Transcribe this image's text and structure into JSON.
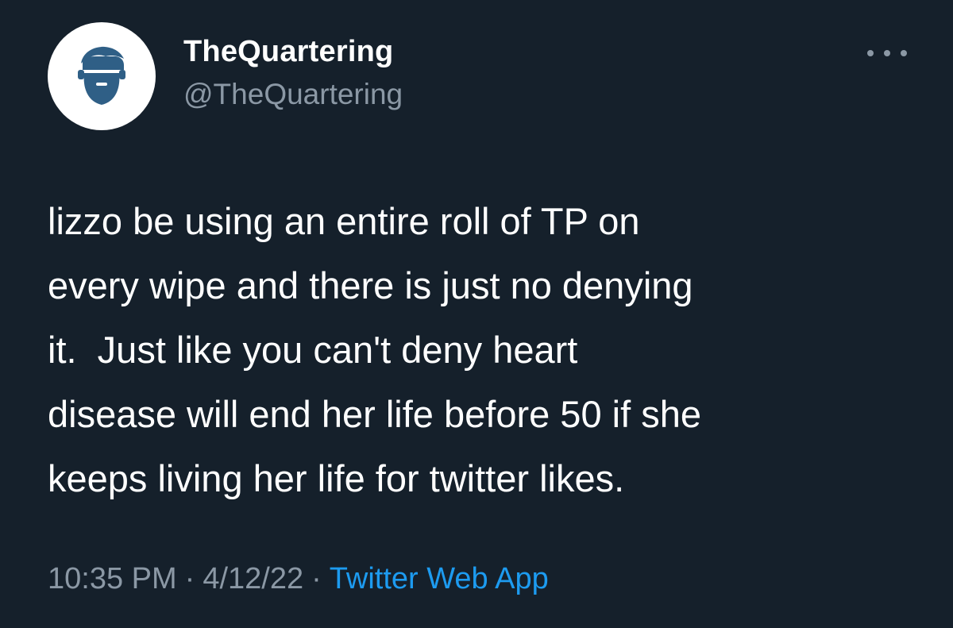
{
  "author": {
    "display_name": "TheQuartering",
    "handle": "@TheQuartering",
    "avatar_icon": "bearded-man-icon"
  },
  "more_icon": "more-dots-icon",
  "tweet": {
    "lines": [
      "lizzo be using an entire roll of TP on",
      "every wipe and there is just no denying",
      "it.  Just like you can't deny heart",
      "disease will end her life before 50 if she",
      "keeps living her life for twitter likes."
    ]
  },
  "meta": {
    "time": "10:35 PM",
    "separator": "·",
    "date": "4/12/22",
    "source": "Twitter Web App"
  },
  "colors": {
    "background": "#15202b",
    "text": "#ffffff",
    "secondary_text": "#8b98a5",
    "link": "#1d9bf0",
    "avatar_bg": "#ffffff",
    "avatar_figure": "#2f5f86"
  }
}
